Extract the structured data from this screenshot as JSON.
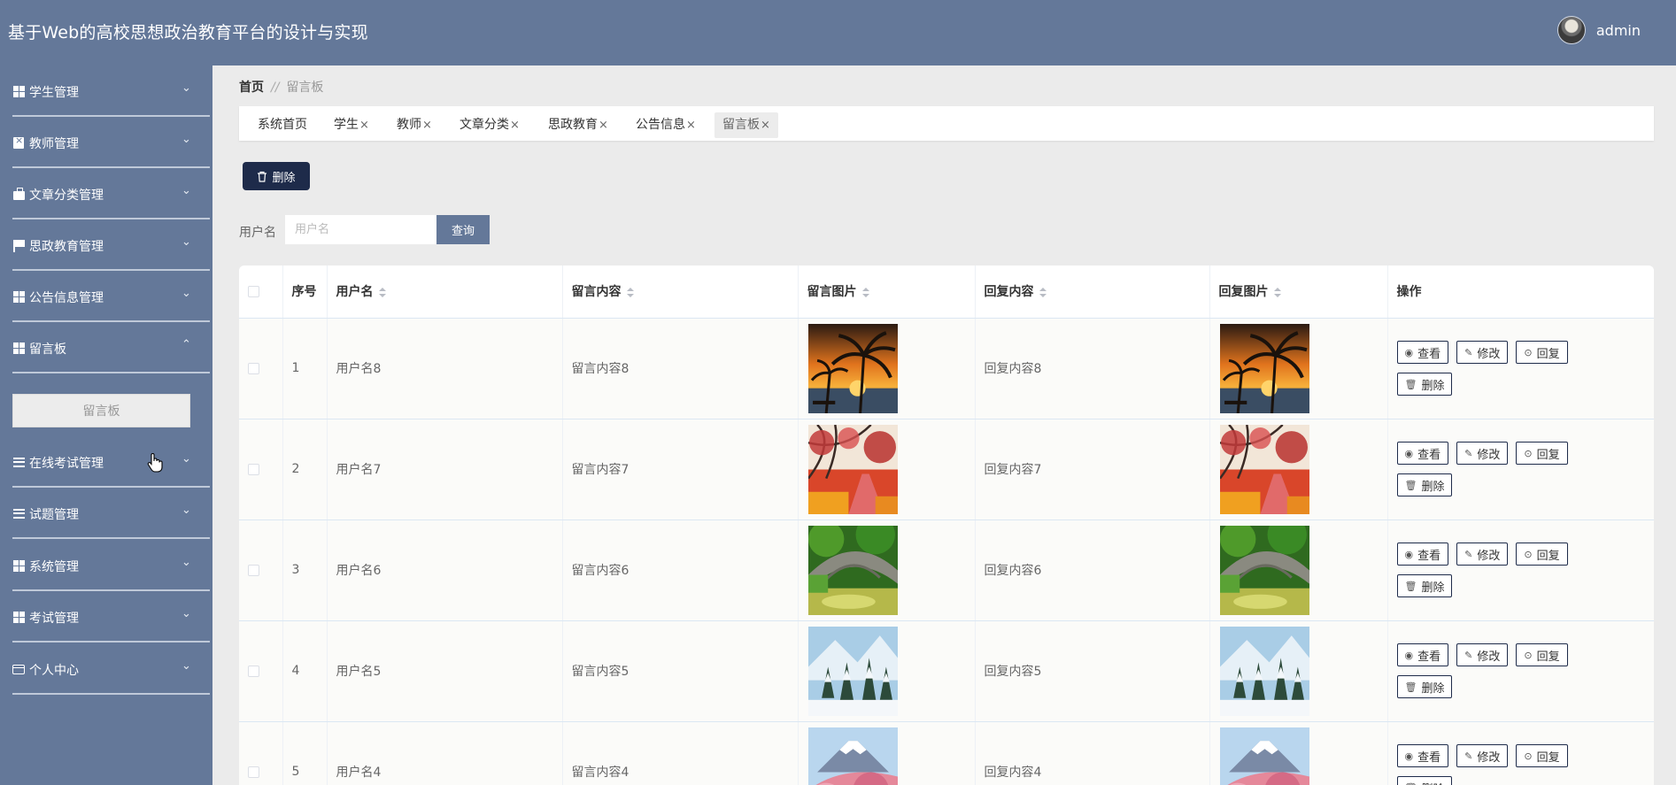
{
  "header": {
    "title": "基于Web的高校思想政治教育平台的设计与实现",
    "username": "admin"
  },
  "sidebar": {
    "items": [
      {
        "label": "学生管理",
        "chevron": "⌄"
      },
      {
        "label": "教师管理",
        "chevron": "⌄"
      },
      {
        "label": "文章分类管理",
        "chevron": "⌄"
      },
      {
        "label": "思政教育管理",
        "chevron": "⌄"
      },
      {
        "label": "公告信息管理",
        "chevron": "⌄"
      },
      {
        "label": "留言板",
        "chevron": "⌃"
      },
      {
        "label": "在线考试管理",
        "chevron": "⌄"
      },
      {
        "label": "试题管理",
        "chevron": "⌄"
      },
      {
        "label": "系统管理",
        "chevron": "⌄"
      },
      {
        "label": "考试管理",
        "chevron": "⌄"
      },
      {
        "label": "个人中心",
        "chevron": "⌄"
      }
    ],
    "sub_item": "留言板"
  },
  "breadcrumb": {
    "home": "首页",
    "sep": "//",
    "current": "留言板"
  },
  "tabs": [
    {
      "label": "系统首页",
      "close": ""
    },
    {
      "label": "学生",
      "close": "×"
    },
    {
      "label": "教师",
      "close": "×"
    },
    {
      "label": "文章分类",
      "close": "×"
    },
    {
      "label": "思政教育",
      "close": "×"
    },
    {
      "label": "公告信息",
      "close": "×"
    },
    {
      "label": "留言板",
      "close": "×"
    }
  ],
  "toolbar": {
    "delete_label": "删除"
  },
  "search": {
    "label": "用户名",
    "placeholder": "用户名",
    "button": "查询"
  },
  "table": {
    "headers": {
      "index": "序号",
      "username": "用户名",
      "content": "留言内容",
      "image": "留言图片",
      "reply": "回复内容",
      "reply_image": "回复图片",
      "ops": "操作"
    },
    "rows": [
      {
        "index": "1",
        "username": "用户名8",
        "content": "留言内容8",
        "reply": "回复内容8",
        "image": "sunset-palm"
      },
      {
        "index": "2",
        "username": "用户名7",
        "content": "留言内容7",
        "reply": "回复内容7",
        "image": "autumn-path"
      },
      {
        "index": "3",
        "username": "用户名6",
        "content": "留言内容6",
        "reply": "回复内容6",
        "image": "stone-bridge"
      },
      {
        "index": "4",
        "username": "用户名5",
        "content": "留言内容5",
        "reply": "回复内容5",
        "image": "snow-forest"
      },
      {
        "index": "5",
        "username": "用户名4",
        "content": "留言内容4",
        "reply": "回复内容4",
        "image": "fuji-blossom"
      }
    ],
    "actions": {
      "view": "查看",
      "edit": "修改",
      "reply": "回复",
      "delete": "删除"
    }
  }
}
